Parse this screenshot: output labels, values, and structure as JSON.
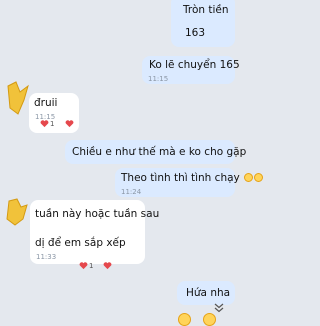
{
  "messages": [
    {
      "id": "m1",
      "text": "Tròn tiền"
    },
    {
      "id": "m2",
      "text": "163"
    },
    {
      "id": "m3",
      "text": "Ko lẽ chuyển 165",
      "time": "11:15"
    },
    {
      "id": "m4",
      "text": "đruii",
      "time": "11:15"
    },
    {
      "id": "m5",
      "text": "Chiều e như thế mà e ko cho gặp"
    },
    {
      "id": "m6",
      "text": "Theo tình thì tình chạy",
      "time": "11:24"
    },
    {
      "id": "m7",
      "text": "tuần này hoặc tuần sau"
    },
    {
      "id": "m8",
      "text": "dị để em sắp xếp",
      "time": "11:33"
    },
    {
      "id": "m9",
      "text": "Hứa nha"
    }
  ],
  "reactions": {
    "m4_count": "1",
    "m8_count": "1"
  },
  "colors": {
    "background": "#e4e8ee",
    "sent_bubble": "#dbeaff",
    "received_bubble": "#ffffff",
    "timestamp": "#8b97a6",
    "heart": "#e5484d"
  },
  "icons": {
    "scroll_down": "chevron-double-down-icon",
    "reaction": "heart-icon",
    "emoji": "grinning-face-emoji"
  }
}
